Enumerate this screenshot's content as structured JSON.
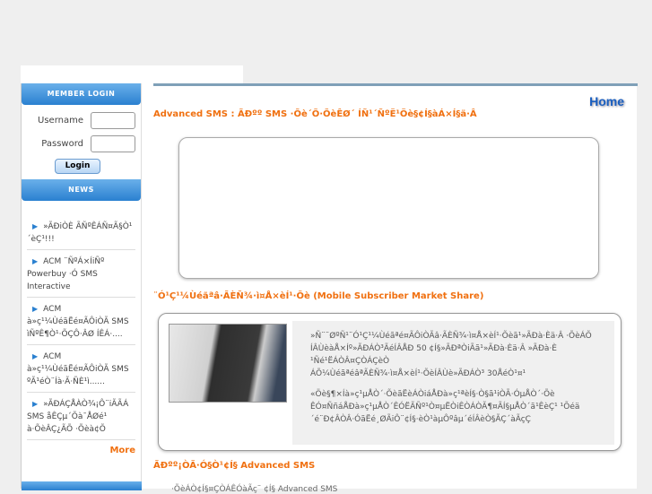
{
  "sidebar": {
    "login_title": "MEMBER LOGIN",
    "username_label": "Username",
    "password_label": "Password",
    "login_button": "Login",
    "news_title": "NEWS",
    "news": [
      "»ÃÐiÒÈ ÃÑºÊÁÑ¤Ã§Ò¹ ´èÇ¹!!!",
      "ACM ¨ÑºÁ×ÍiÑº Powerbuy ·Ó SMS Interactive",
      "ACM à»ç¹¼ÙéãËé¤ÃÔiÒÃ SMS ìÑºÊ¶Ò¹·ÕÇÔ·ÂØ ÍÊÁ·....",
      "ACM à»ç¹¼ÙéãËé¤ÃÔiÒÃ SMS ºÃ¹éÒ¨Íà·Ã·ÑÈ¹ì......",
      "»ÃÐÁÇÅÀÒ¾¡Ô¨iÃÃÁ SMS åÊÇµ´Õà¯ÅØé¹ à·ÕèÂÇ¿ÃÕ ·Õèà¢Õ"
    ],
    "more": "More"
  },
  "main": {
    "home": "Home",
    "title1": "Advanced SMS : ÃÐºº SMS ·Õè´Õ·ÕèÊØ´ ÍÑ¹´ÑºË¹Öè§¢Í§àÁ×Í§ä·Â",
    "title2": "¨Ó¹Ç¹¼Ùéãªâ·ÃÈÑ¾·ì¤Å×èÍ¹·Õè (Mobile Subscriber Market Share)",
    "box_text": [
      "»Ñ¨¨ØºÑ¹¨Ó¹Ç¹¼Ùéãªé¤ÃÔiÒÃâ·ÃÈÑ¾·ì¤Å×èÍ¹·Õèã¹»ÃÐà·Èä·Â ·ÕèÁÕ",
      "ÍÂÙèàÅ×Íº»ÃÐÁÒ³ÃéÍÂÅÐ 50 ¢Í§»ÃÐªÒiÃã¹»ÃÐà·Èä·Â »ÃÐà·È ¹Ñé¹ËÁÒÂ¤ÇÒÁÇèÒ",
      "ÁÕ¼ÙéãªéâªÃÈÑ¾·ì¤Å×èÍ¹·ÕèÍÂÙè»ÃÐÁÒ³ 30ÅéÒ¹¤¹",
      "«Öè§¶×Íà»ç¹µÅÒ´·ÕèãËèÁÒiáÅÐà»ç¹ªèÍ§·Ò§ã¹iÒÃ·ÓµÅÒ´·Õè ÊÓ¤ÑñáÅÐà»ç¹µÅÒ´ÊÓËÃÑº¹Ò¤µËÒiÊÒÁÒÃ¶¤ÃÍ§µÅÒ´ã¹ÊèÇ¹ ¹Õéä´é¨Ð¢ÂÒÂ·ÓãËé¸ØÃiÔ¨¢Í§·èÒ¹àµÔºâµ´éÍÂèÒ§ÃÇ´àÃçÇ"
    ],
    "title3": "ÃÐºº¡ÒÃ·Ó§Ò¹¢Í§ Advanced SMS",
    "last_line": "·ÕèÁÒ¢Í§¤ÇÒÁÊÓàÃç¨ ¢Í§ Advanced SMS"
  }
}
